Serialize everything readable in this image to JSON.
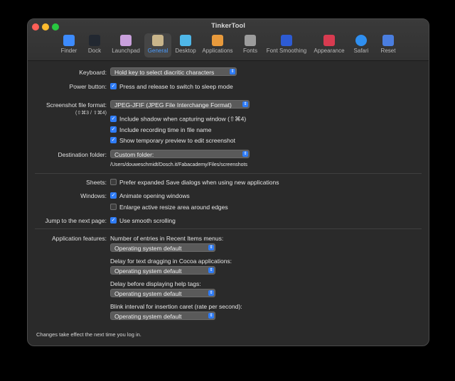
{
  "window": {
    "title": "TinkerTool"
  },
  "toolbar": {
    "items": [
      {
        "label": "Finder",
        "icon": "finder-icon",
        "color": "#3d8bfd"
      },
      {
        "label": "Dock",
        "icon": "dock-icon",
        "color": "#222831"
      },
      {
        "label": "Launchpad",
        "icon": "launchpad-icon",
        "color": "#c9a0dc"
      },
      {
        "label": "General",
        "icon": "general-icon",
        "color": "#c9b58a",
        "active": true
      },
      {
        "label": "Desktop",
        "icon": "desktop-icon",
        "color": "#4fb7e8"
      },
      {
        "label": "Applications",
        "icon": "applications-icon",
        "color": "#e89a3c"
      },
      {
        "label": "Fonts",
        "icon": "fonts-icon",
        "color": "#9c9c9c"
      },
      {
        "label": "Font Smoothing",
        "icon": "font-smoothing-icon",
        "color": "#2d5bd4"
      },
      {
        "label": "Appearance",
        "icon": "appearance-icon",
        "color": "#d83b50"
      },
      {
        "label": "Safari",
        "icon": "safari-icon",
        "color": "#2f8ff0"
      },
      {
        "label": "Reset",
        "icon": "reset-icon",
        "color": "#4a7ee0"
      }
    ]
  },
  "keyboard": {
    "label": "Keyboard:",
    "value": "Hold key to select diacritic characters"
  },
  "power_button": {
    "label": "Power button:",
    "option": "Press and release to switch to sleep mode",
    "checked": true
  },
  "screenshot": {
    "label": "Screenshot file format:",
    "shortcut": "(⇧⌘3 / ⇧⌘4)",
    "value": "JPEG-JFIF (JPEG File Interchange Format)",
    "options": [
      {
        "text": "Include shadow when capturing window (⇧⌘4)",
        "checked": true
      },
      {
        "text": "Include recording time in file name",
        "checked": true
      },
      {
        "text": "Show temporary preview to edit screenshot",
        "checked": true
      }
    ]
  },
  "destination": {
    "label": "Destination folder:",
    "value": "Custom folder:",
    "path": "/Users/douweschmidt/Dosch.it/Fabacademy/Files/screenshots"
  },
  "sheets": {
    "label": "Sheets:",
    "option": "Prefer expanded Save dialogs when using new applications",
    "checked": false
  },
  "windows": {
    "label": "Windows:",
    "options": [
      {
        "text": "Animate opening windows",
        "checked": true
      },
      {
        "text": "Enlarge active resize area around edges",
        "checked": false
      }
    ]
  },
  "jump": {
    "label": "Jump to the next page:",
    "option": "Use smooth scrolling",
    "checked": true
  },
  "app_features": {
    "label": "Application features:",
    "groups": [
      {
        "title": "Number of entries in Recent Items menus:",
        "value": "Operating system default"
      },
      {
        "title": "Delay for text dragging in Cocoa applications:",
        "value": "Operating system default"
      },
      {
        "title": "Delay before displaying help tags:",
        "value": "Operating system default"
      },
      {
        "title": "Blink interval for insertion caret (rate per second):",
        "value": "Operating system default"
      }
    ]
  },
  "footer": {
    "text": "Changes take effect the next time you log in."
  },
  "glyphs": {
    "check": "✓",
    "stepper": "⇕"
  }
}
